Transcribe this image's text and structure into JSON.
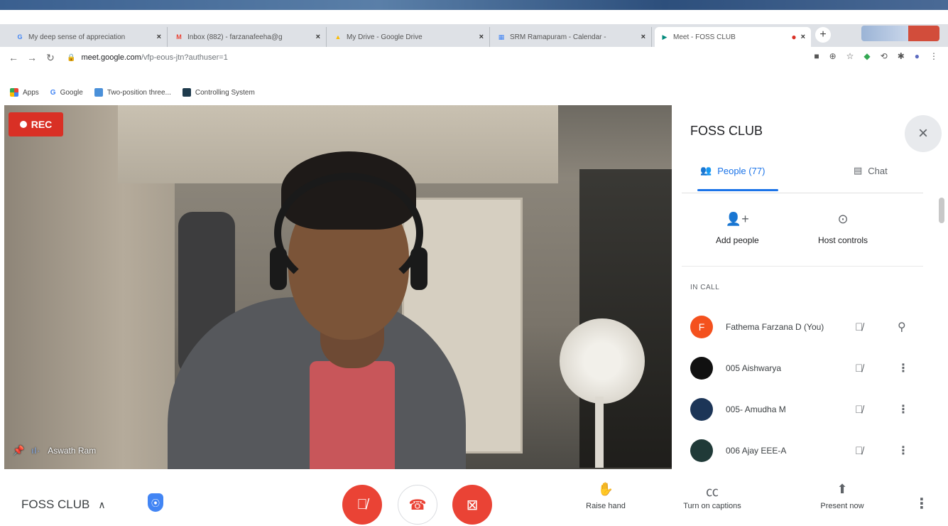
{
  "browser": {
    "tabs": [
      {
        "title": "My deep sense of appreciation",
        "favicon": "G",
        "favicon_color": "#4285f4"
      },
      {
        "title": "Inbox (882) - farzanafeeha@g",
        "favicon": "M",
        "favicon_color": "#ea4335"
      },
      {
        "title": "My Drive - Google Drive",
        "favicon": "▲",
        "favicon_color": "#fbbc04"
      },
      {
        "title": "SRM Ramapuram - Calendar -",
        "favicon": "▦",
        "favicon_color": "#4285f4"
      },
      {
        "title": "Meet - FOSS CLUB",
        "favicon": "▶",
        "favicon_color": "#00897b"
      }
    ],
    "close_glyph": "×",
    "new_tab_glyph": "+",
    "url_host": "meet.google.com",
    "url_path": "/vfp-eous-jtn?authuser=1",
    "bookmarks": [
      {
        "label": "Apps"
      },
      {
        "label": "Google"
      },
      {
        "label": "Two-position three..."
      },
      {
        "label": "Controlling System"
      }
    ]
  },
  "video": {
    "rec_label": "REC",
    "participant_name": "Aswath Ram"
  },
  "panel": {
    "title": "FOSS CLUB",
    "tab_people": "People (77)",
    "tab_chat": "Chat",
    "add_people": "Add people",
    "host_controls": "Host controls",
    "in_call_heading": "IN CALL",
    "participants": [
      {
        "name": "Fathema Farzana D (You)",
        "avatar_letter": "F",
        "avatar_color": "#f4511e"
      },
      {
        "name": "005 Aishwarya",
        "avatar_letter": "",
        "avatar_color": "#111111"
      },
      {
        "name": "005- Amudha M",
        "avatar_letter": "",
        "avatar_color": "#1c3557"
      },
      {
        "name": "006 Ajay EEE-A",
        "avatar_letter": "",
        "avatar_color": "#203a38"
      }
    ]
  },
  "bottom": {
    "meeting_name": "FOSS CLUB",
    "raise_hand": "Raise hand",
    "captions": "Turn on captions",
    "present": "Present now"
  },
  "colors": {
    "accent": "#1a73e8",
    "danger": "#ea4335",
    "rec": "#d93025"
  }
}
